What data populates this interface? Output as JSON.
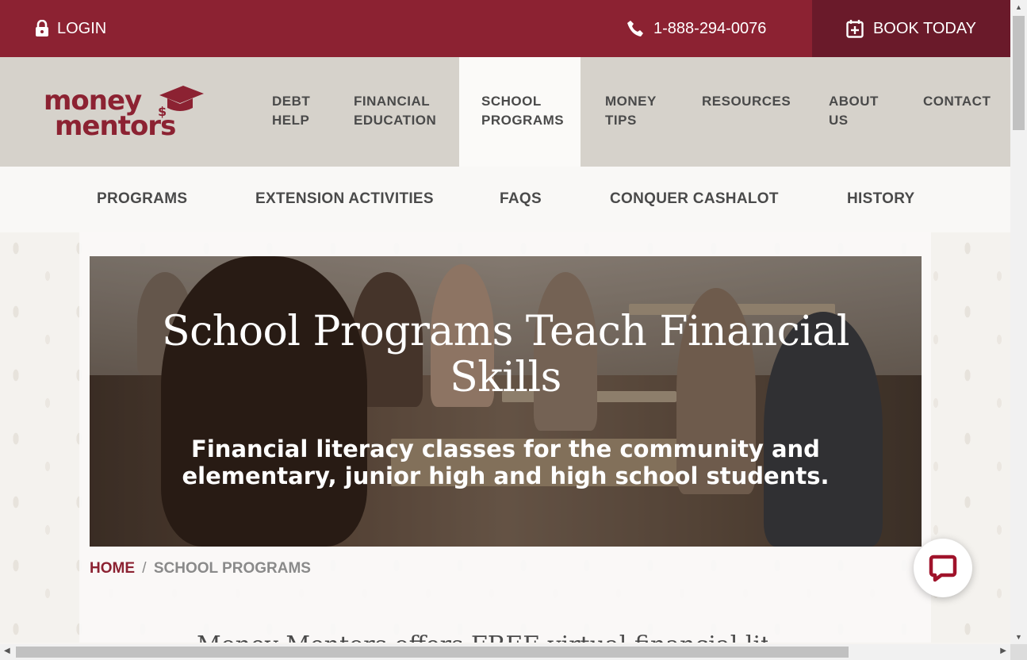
{
  "topbar": {
    "login_label": "LOGIN",
    "phone": "1-888-294-0076",
    "book_label": "BOOK TODAY"
  },
  "logo": {
    "line1": "money",
    "line2": "mentors"
  },
  "nav": {
    "debt_help": [
      "DEBT",
      "HELP"
    ],
    "financial_education": [
      "FINANCIAL",
      "EDUCATION"
    ],
    "school_programs": [
      "SCHOOL",
      "PROGRAMS"
    ],
    "money_tips": [
      "MONEY",
      "TIPS"
    ],
    "resources": "RESOURCES",
    "about_us": [
      "ABOUT",
      "US"
    ],
    "contact": "CONTACT"
  },
  "subnav": {
    "programs": "PROGRAMS",
    "extension_activities": "EXTENSION ACTIVITIES",
    "faqs": "FAQS",
    "conquer_cashalot": "CONQUER CASHALOT",
    "history": "HISTORY"
  },
  "hero": {
    "title_line1": "School Programs Teach Financial",
    "title_line2": "Skills",
    "subtitle_line1": "Financial literacy classes for the community and",
    "subtitle_line2": "elementary, junior high and high school students."
  },
  "breadcrumb": {
    "home": "HOME",
    "separator": "/",
    "current": "SCHOOL PROGRAMS"
  },
  "intro": {
    "partial_text": "Money Mentors offers FREE virtual financial literacy"
  },
  "colors": {
    "brand": "#8c2232",
    "brand_dark": "#6a1a2a",
    "nav_bg": "#d6d2cb"
  }
}
